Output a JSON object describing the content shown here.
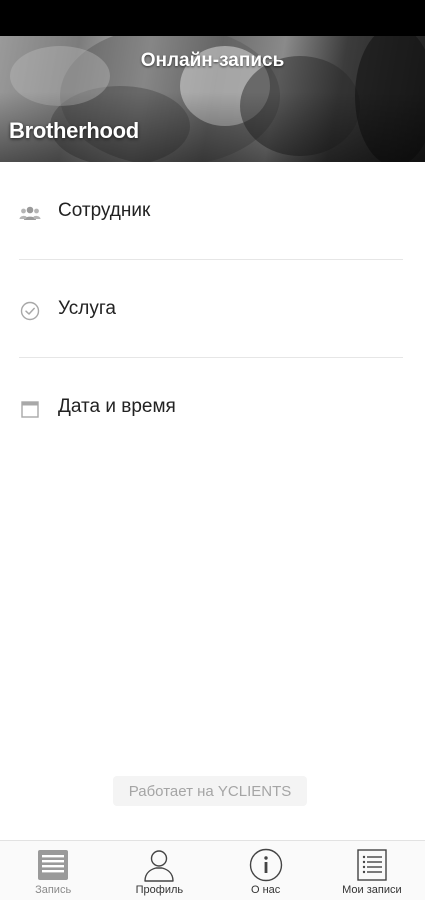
{
  "header": {
    "title": "Онлайн-запись",
    "brand": "Brotherhood"
  },
  "menu": {
    "items": [
      {
        "label": "Сотрудник",
        "icon": "people-icon"
      },
      {
        "label": "Услуга",
        "icon": "check-circle-icon"
      },
      {
        "label": "Дата и время",
        "icon": "calendar-icon"
      }
    ]
  },
  "footer": {
    "powered_by": "Работает на YCLIENTS"
  },
  "tabbar": {
    "tabs": [
      {
        "label": "Запись",
        "icon": "booking-list-icon",
        "active": true
      },
      {
        "label": "Профиль",
        "icon": "profile-icon",
        "active": false
      },
      {
        "label": "О нас",
        "icon": "info-icon",
        "active": false
      },
      {
        "label": "Мои записи",
        "icon": "my-bookings-icon",
        "active": false
      }
    ]
  },
  "colors": {
    "text": "#222222",
    "divider": "#e6e6e6",
    "tab_inactive_icon": "#444444",
    "tab_active_icon": "#9a9a9a"
  }
}
